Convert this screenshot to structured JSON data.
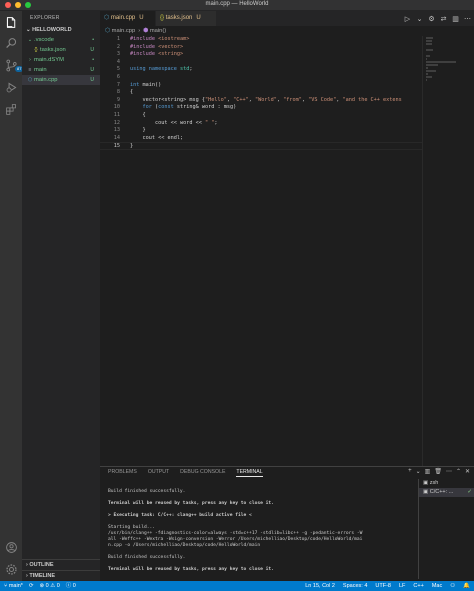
{
  "window": {
    "title": "main.cpp — HelloWorld"
  },
  "activity": {
    "scm_badge": "87"
  },
  "sidebar": {
    "header": "EXPLORER",
    "project": "HELLOWORLD",
    "items": [
      {
        "label": ".vscode",
        "icon": "chevron-down",
        "badge": "•",
        "color": "#73c991"
      },
      {
        "label": "tasks.json",
        "icon": "{}",
        "badge": "U",
        "color": "#73c991"
      },
      {
        "label": "main.dSYM",
        "icon": "chevron-right",
        "badge": "•",
        "color": "#73c991"
      },
      {
        "label": "main",
        "icon": "binary",
        "badge": "U",
        "color": "#73c991"
      },
      {
        "label": "main.cpp",
        "icon": "cpp",
        "badge": "U",
        "color": "#73c991"
      }
    ],
    "outline": "OUTLINE",
    "timeline": "TIMELINE"
  },
  "tabs": [
    {
      "label": "main.cpp",
      "status": "U"
    },
    {
      "label": "tasks.json",
      "status": "U"
    }
  ],
  "breadcrumb": {
    "file": "main.cpp",
    "symbol": "main()"
  },
  "code": {
    "lines": [
      {
        "n": "1",
        "tokens": [
          [
            "pp",
            "#include "
          ],
          [
            "str",
            "<iostream>"
          ]
        ]
      },
      {
        "n": "2",
        "tokens": [
          [
            "pp",
            "#include "
          ],
          [
            "str",
            "<vector>"
          ]
        ]
      },
      {
        "n": "3",
        "tokens": [
          [
            "pp",
            "#include "
          ],
          [
            "str",
            "<string>"
          ]
        ]
      },
      {
        "n": "4",
        "tokens": []
      },
      {
        "n": "5",
        "tokens": [
          [
            "kw",
            "using namespace "
          ],
          [
            "ty",
            "std"
          ],
          [
            "plain",
            ";"
          ]
        ]
      },
      {
        "n": "6",
        "tokens": []
      },
      {
        "n": "7",
        "tokens": [
          [
            "kw",
            "int "
          ],
          [
            "plain",
            "main()"
          ]
        ]
      },
      {
        "n": "8",
        "tokens": [
          [
            "plain",
            "{"
          ]
        ]
      },
      {
        "n": "9",
        "tokens": [
          [
            "plain",
            "    vector<string> msg {"
          ],
          [
            "str",
            "\"Hello\""
          ],
          [
            "plain",
            ", "
          ],
          [
            "str",
            "\"C++\""
          ],
          [
            "plain",
            ", "
          ],
          [
            "str",
            "\"World\""
          ],
          [
            "plain",
            ", "
          ],
          [
            "str",
            "\"from\""
          ],
          [
            "plain",
            ", "
          ],
          [
            "str",
            "\"VS Code\""
          ],
          [
            "plain",
            ", "
          ],
          [
            "str",
            "\"and the C++ extens"
          ]
        ]
      },
      {
        "n": "10",
        "tokens": [
          [
            "kw",
            "    for "
          ],
          [
            "plain",
            "("
          ],
          [
            "kw",
            "const "
          ],
          [
            "plain",
            "string& word : msg)"
          ]
        ]
      },
      {
        "n": "11",
        "tokens": [
          [
            "plain",
            "    {"
          ]
        ]
      },
      {
        "n": "12",
        "tokens": [
          [
            "plain",
            "        cout << word << "
          ],
          [
            "str",
            "\" \""
          ],
          [
            "plain",
            ";"
          ]
        ]
      },
      {
        "n": "13",
        "tokens": [
          [
            "plain",
            "    }"
          ]
        ]
      },
      {
        "n": "14",
        "tokens": [
          [
            "plain",
            "    cout << endl;"
          ]
        ]
      },
      {
        "n": "15",
        "tokens": [
          [
            "plain",
            "}"
          ]
        ]
      }
    ],
    "current_line": "15"
  },
  "panel": {
    "tabs": [
      "PROBLEMS",
      "OUTPUT",
      "DEBUG CONSOLE",
      "TERMINAL"
    ],
    "active_tab": "TERMINAL",
    "terminal_lines": [
      {
        "text": "",
        "bold": false
      },
      {
        "text": "Build finished successfully.",
        "bold": false
      },
      {
        "text": "",
        "bold": false
      },
      {
        "text": "Terminal will be reused by tasks, press any key to close it.",
        "bold": true
      },
      {
        "text": "",
        "bold": false
      },
      {
        "text": "> Executing task: C/C++: clang++ build active file <",
        "bold": true
      },
      {
        "text": "",
        "bold": false
      },
      {
        "text": "Starting build...",
        "bold": false
      },
      {
        "text": "/usr/bin/clang++ -fdiagnostics-color=always -std=c++17 -stdlib=libc++ -g -pedantic-errors -W",
        "bold": false
      },
      {
        "text": "all -Weffc++ -Wextra -Wsign-conversion -Werror /Users/michelliao/Desktop/code/HelloWorld/mai",
        "bold": false
      },
      {
        "text": "n.cpp -o /Users/michelliao/Desktop/code/HelloWorld/main",
        "bold": false
      },
      {
        "text": "",
        "bold": false
      },
      {
        "text": "Build finished successfully.",
        "bold": false
      },
      {
        "text": "",
        "bold": false
      },
      {
        "text": "Terminal will be reused by tasks, press any key to close it.",
        "bold": true
      }
    ],
    "terminals": [
      {
        "label": "zsh"
      },
      {
        "label": "C/C++: ..."
      }
    ]
  },
  "status": {
    "branch": "main*",
    "errors": "0",
    "warnings": "0",
    "info": "0",
    "position": "Ln 15, Col 2",
    "spaces": "Spaces: 4",
    "encoding": "UTF-8",
    "eol": "LF",
    "language": "C++",
    "platform": "Mac"
  },
  "colors": {
    "accent": "#007acc",
    "untracked": "#73c991",
    "modified": "#e2c08d"
  }
}
